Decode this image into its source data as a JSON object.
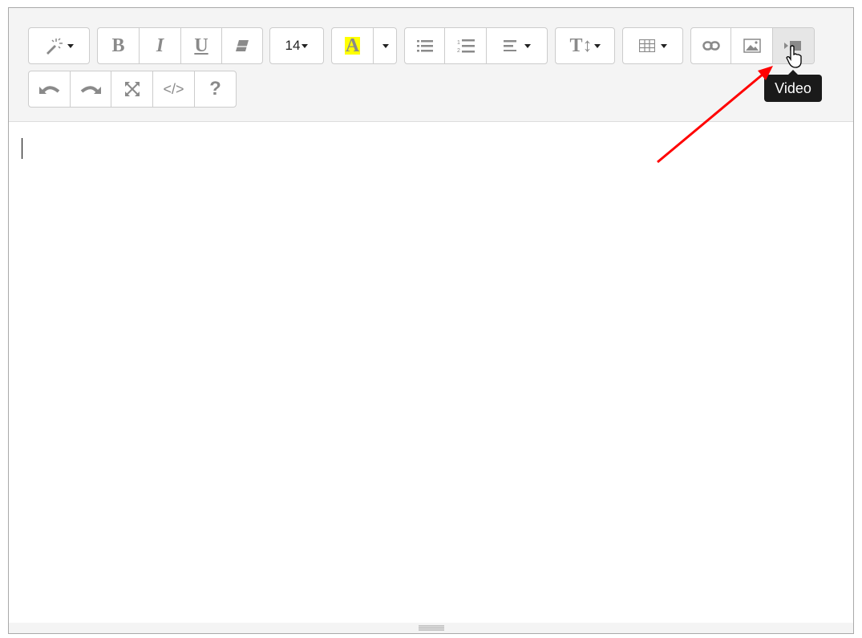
{
  "toolbar": {
    "font_size": "14",
    "highlight_letter": "A",
    "highlight_color": "#ffff00",
    "bold": "B",
    "italic": "I",
    "underline": "U",
    "code_view": "</>",
    "help": "?"
  },
  "tooltip": {
    "text": "Video"
  },
  "annotation_color": "#ff0000"
}
